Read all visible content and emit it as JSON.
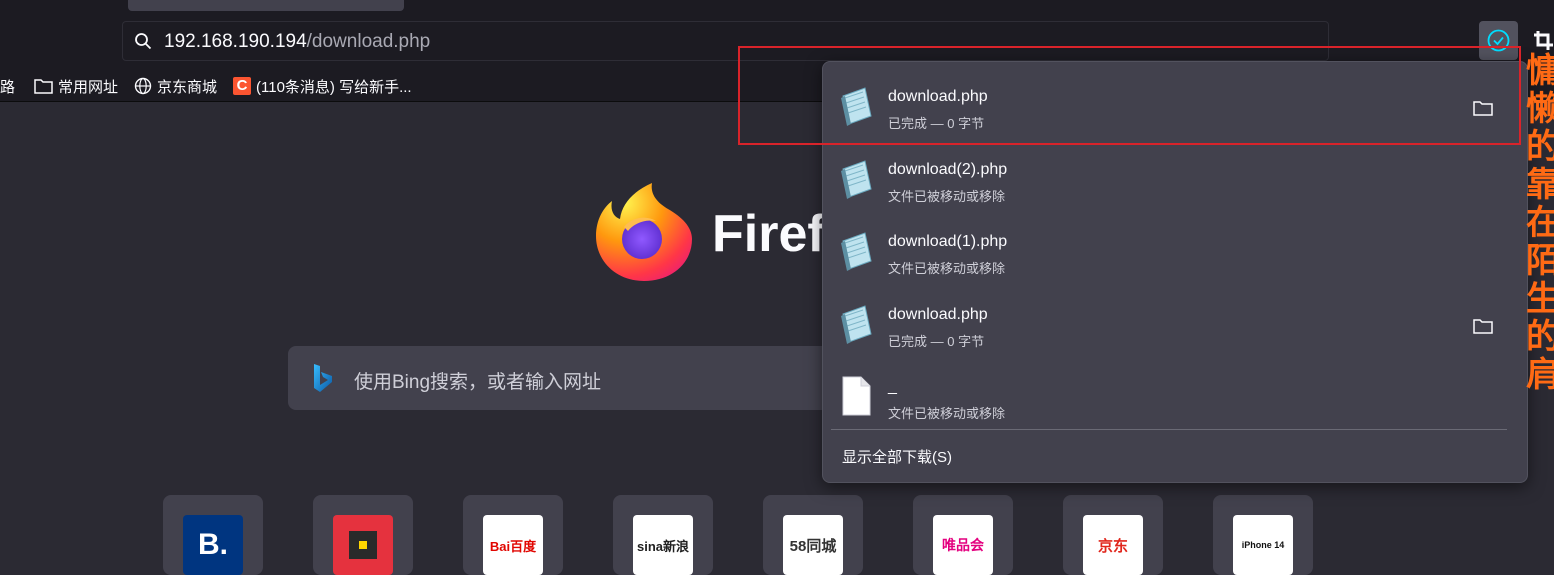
{
  "toolbar": {
    "url_host": "192.168.190.194",
    "url_path": "/download.php"
  },
  "bookmarks": [
    {
      "label": "路",
      "icon": "none"
    },
    {
      "label": "常用网址",
      "icon": "folder-icon"
    },
    {
      "label": "京东商城",
      "icon": "globe-icon"
    },
    {
      "label": "(110条消息) 写给新手...",
      "icon": "csdn-icon",
      "icon_text": "C"
    }
  ],
  "newtab": {
    "brand": "Firefox",
    "search_placeholder": "使用Bing搜索，或者输入网址",
    "tiles": [
      {
        "name": "booking",
        "text": "B.",
        "bg": "#003580",
        "fg": "#ffffff"
      },
      {
        "name": "app",
        "text": "",
        "bg": "#e5323e",
        "fg": "#ffffff"
      },
      {
        "name": "baidu",
        "text": "Bai百度",
        "bg": "#ffffff",
        "fg": "#e10601"
      },
      {
        "name": "sina",
        "text": "sina新浪",
        "bg": "#ffffff",
        "fg": "#222222"
      },
      {
        "name": "58",
        "text": "58同城",
        "bg": "#ffffff",
        "fg": "#333333"
      },
      {
        "name": "vip",
        "text": "唯品会",
        "bg": "#ffffff",
        "fg": "#e4007f"
      },
      {
        "name": "jd",
        "text": "京东",
        "bg": "#ffffff",
        "fg": "#e1251b"
      },
      {
        "name": "apple",
        "text": "iPhone 14",
        "bg": "#ffffff",
        "fg": "#111111"
      }
    ]
  },
  "downloads": {
    "items": [
      {
        "filename": "download.php",
        "status": "已完成 — 0 字节",
        "has_folder": true,
        "file_icon": "php-file-icon"
      },
      {
        "filename": "download(2).php",
        "status": "文件已被移动或移除",
        "has_folder": false,
        "file_icon": "php-file-icon"
      },
      {
        "filename": "download(1).php",
        "status": "文件已被移动或移除",
        "has_folder": false,
        "file_icon": "php-file-icon"
      },
      {
        "filename": "download.php",
        "status": "已完成 — 0 字节",
        "has_folder": true,
        "file_icon": "php-file-icon"
      },
      {
        "filename": "_",
        "status": "文件已被移动或移除",
        "has_folder": false,
        "file_icon": "blank-file-icon"
      }
    ],
    "show_all": "显示全部下载(S)"
  },
  "side_text": "慵懒的靠在陌生的肩",
  "colors": {
    "accent": "#00ddff",
    "highlight_border": "#d9232a",
    "side_text": "#ff6a14"
  }
}
